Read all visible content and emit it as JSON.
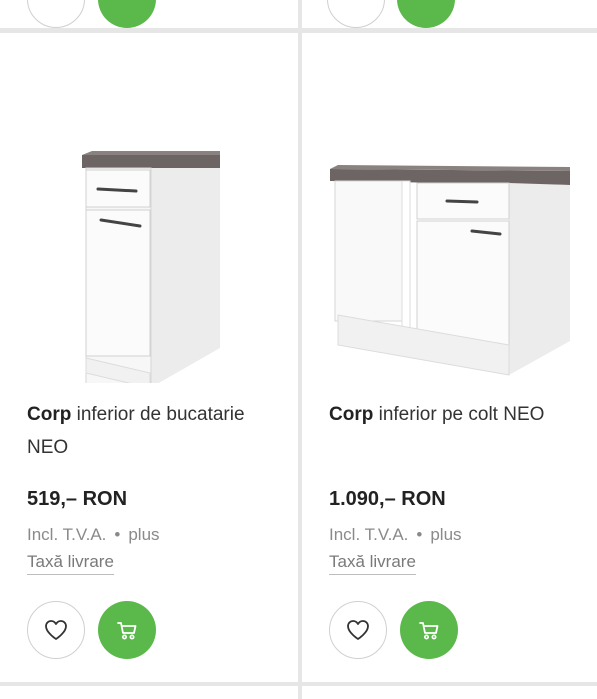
{
  "colors": {
    "accent_green": "#5bb84a",
    "background": "#e6e6e6",
    "card": "#ffffff",
    "text_dark": "#222222",
    "text_muted": "#8a8a8a"
  },
  "products": [
    {
      "title_bold": "Corp",
      "title_rest": " inferior de bucatarie NEO",
      "price": "519,– RON",
      "vat_prefix": "Incl. T.V.A.",
      "vat_dot": "•",
      "vat_suffix": "plus",
      "delivery": "Taxă livrare",
      "wishlist_icon": "heart-icon",
      "cart_icon": "cart-icon"
    },
    {
      "title_bold": "Corp",
      "title_rest": " inferior pe colt NEO",
      "price": "1.090,– RON",
      "vat_prefix": "Incl. T.V.A.",
      "vat_dot": "•",
      "vat_suffix": "plus",
      "delivery": "Taxă livrare",
      "wishlist_icon": "heart-icon",
      "cart_icon": "cart-icon"
    }
  ]
}
